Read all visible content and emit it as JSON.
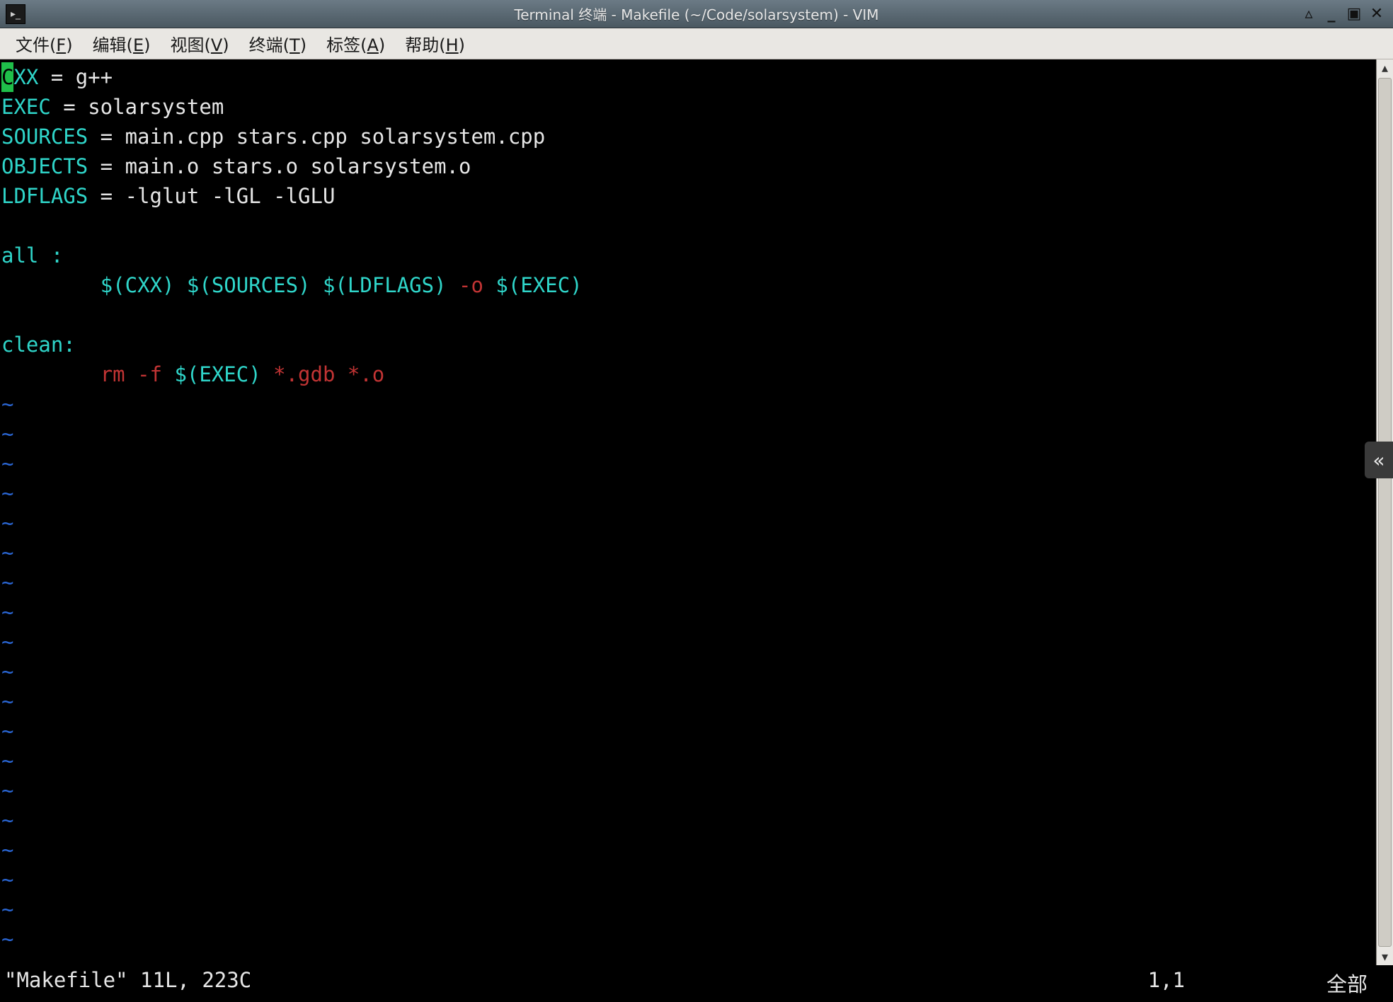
{
  "window": {
    "title": "Terminal 终端 - Makefile (~/Code/solarsystem) - VIM"
  },
  "menu": {
    "file": {
      "pre": "文件(",
      "key": "F",
      "post": ")"
    },
    "edit": {
      "pre": "编辑(",
      "key": "E",
      "post": ")"
    },
    "view": {
      "pre": "视图(",
      "key": "V",
      "post": ")"
    },
    "terminal": {
      "pre": "终端(",
      "key": "T",
      "post": ")"
    },
    "tabs": {
      "pre": "标签(",
      "key": "A",
      "post": ")"
    },
    "help": {
      "pre": "帮助(",
      "key": "H",
      "post": ")"
    }
  },
  "colors": {
    "cyan": "#2fd5c9",
    "red": "#c23434",
    "cursor": "#1fbf4a"
  },
  "make": {
    "l1": {
      "cursor": "C",
      "var": "XX",
      "rest": " = g++"
    },
    "l2": {
      "var": "EXEC",
      "rest": " = solarsystem"
    },
    "l3": {
      "var": "SOURCES",
      "rest": " = main.cpp stars.cpp solarsystem.cpp"
    },
    "l4": {
      "var": "OBJECTS",
      "rest": " = main.o stars.o solarsystem.o"
    },
    "l5": {
      "var": "LDFLAGS",
      "rest": " = -lglut -lGL -lGLU"
    },
    "blank1": "",
    "l7": {
      "target": "all :"
    },
    "l8": {
      "indent": "        ",
      "a": "$(CXX) $(SOURCES) $(LDFLAGS) ",
      "flag": "-o",
      "b": " $(EXEC)"
    },
    "blank2": "",
    "l10": {
      "target": "clean:"
    },
    "l11": {
      "indent": "        ",
      "a": "rm -f ",
      "b": "$(EXEC)",
      "c": " *.gdb *.o"
    }
  },
  "tilde": "~",
  "tilde_count": 19,
  "status": {
    "left": "\"Makefile\" 11L, 223C",
    "pos": "1,1",
    "right": "全部"
  },
  "side_tab": "«"
}
